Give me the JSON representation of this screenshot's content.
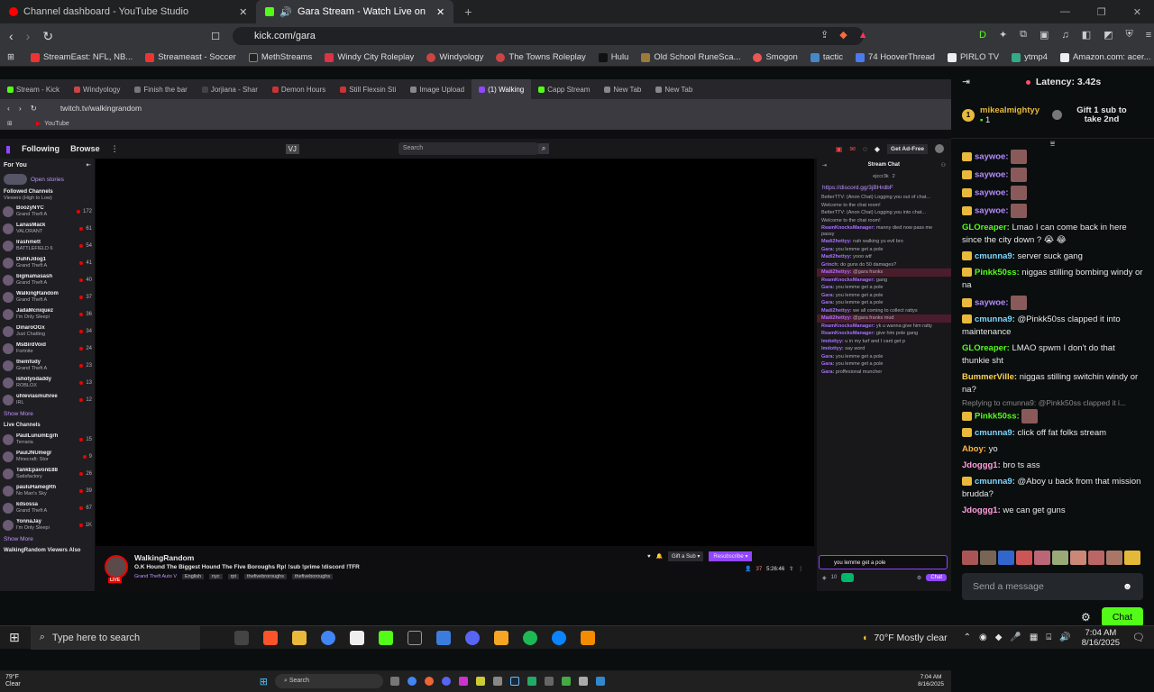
{
  "outer_tabs": [
    {
      "label": "Channel dashboard - YouTube Studio",
      "color": "#ff0000"
    },
    {
      "label": "Gara Stream - Watch Live on",
      "color": "#53fc18"
    }
  ],
  "outer_url": "kick.com/gara",
  "bookmarks": [
    "StreamEast: NFL, NB...",
    "Streameast - Soccer",
    "MethStreams",
    "Windy City Roleplay",
    "Windyology",
    "The Towns Roleplay",
    "Hulu",
    "Old School RuneSca...",
    "Smogon",
    "tactic",
    "74 HooverThread",
    "PIRLO TV",
    "ytmp4",
    "Amazon.com: acer..."
  ],
  "inner_tabs": [
    "Stream - Kick",
    "Windyology",
    "Finish the bar",
    "Jorjiana - Shar",
    "Demon Hours",
    "Still Flexsin Sti",
    "Image Upload",
    "(1) Walking",
    "Capp Stream",
    "New Tab",
    "New Tab"
  ],
  "inner_url": "twitch.tv/walkingrandom",
  "inner_bookmark": "YouTube",
  "twitch": {
    "following": "Following",
    "browse": "Browse",
    "search": "Search",
    "get_ad_free": "Get Ad-Free",
    "for_you": "For You",
    "open_stories": "Open stories",
    "followed_header": "Followed Channels",
    "followed_sub": "Viewers (High to Low)",
    "followed": [
      {
        "n": "BoozyNYC",
        "g": "Grand Theft A",
        "v": "172"
      },
      {
        "n": "LanasMack",
        "g": "VALORANT",
        "v": "61"
      },
      {
        "n": "Irashmett",
        "g": "BATTLEFIELD 6",
        "v": "54"
      },
      {
        "n": "DuhhJdog1",
        "g": "Grand Theft A",
        "v": "41"
      },
      {
        "n": "bigmamasash",
        "g": "Grand Theft A",
        "v": "40"
      },
      {
        "n": "WalkingRandom",
        "g": "Grand Theft A",
        "v": "37"
      },
      {
        "n": "JadaMcniquez",
        "g": "I'm Only Sleepi",
        "v": "36"
      },
      {
        "n": "DinaroOGx",
        "g": "Just Chatting",
        "v": "34"
      },
      {
        "n": "MsBirdVoid",
        "g": "Fortnite",
        "v": "24"
      },
      {
        "n": "themfudy",
        "g": "Grand Theft A",
        "v": "23"
      },
      {
        "n": "ishotyodaddy",
        "g": "ROBLOX",
        "v": "13"
      },
      {
        "n": "uhleviasmuhree",
        "g": "IRL",
        "v": "12"
      }
    ],
    "show_more": "Show More",
    "live_header": "Live Channels",
    "live": [
      {
        "n": "PaulLunumEgrh",
        "g": "Terraria",
        "v": "15"
      },
      {
        "n": "PaulJNUmegr",
        "g": "Minecraft: Stor",
        "v": "9"
      },
      {
        "n": "TankEpavonE88",
        "g": "Satisfactory",
        "v": "26"
      },
      {
        "n": "pauluHamegRh",
        "g": "No Man's Sky",
        "v": "39"
      },
      {
        "n": "kdsossa",
        "g": "Grand Theft A",
        "v": "67"
      },
      {
        "n": "YonnaJay",
        "g": "I'm Only Sleepi",
        "v": "1K"
      }
    ],
    "viewers_also": "WalkingRandom Viewers Also",
    "weather_temp": "79°F",
    "weather_cond": "Clear",
    "streamer": "WalkingRandom",
    "stream_title": "O.K Hound The Biggest Hound The Five Boroughs Rp! !sub !prime !discord !TFR",
    "stream_tags": [
      "Grand Theft Auto V",
      "English",
      "nyc",
      "rpt",
      "thefivebroroughs",
      "thefiveboroughs"
    ],
    "gift_sub": "Gift a Sub",
    "resubscribe": "Resubscribe",
    "viewers": "37",
    "uptime": "5:26:46",
    "stream_chat": "Stream Chat",
    "chat_user": "ejccr3k",
    "chat_count": "2",
    "discord_link": "https://discord.gg/3jBHrdbF",
    "chat": [
      {
        "u": "",
        "t": "BetterTTV: (Anon Chat) Logging you out of chat..."
      },
      {
        "u": "",
        "t": "Welcome to the chat room!"
      },
      {
        "u": "",
        "t": "BetterTTV: (Anon Chat) Logging you into chat..."
      },
      {
        "u": "",
        "t": "Welcome to the chat room!"
      },
      {
        "u": "ReamKnocksManager:",
        "t": "manny died now pass me passy"
      },
      {
        "u": "Madi2hettyy:",
        "t": "nah walking yu evil bro"
      },
      {
        "u": "Gara:",
        "t": "you lemme get a pole"
      },
      {
        "u": "Madi2hettyy:",
        "t": "yooo wtf"
      },
      {
        "u": "Grinch:",
        "t": "do guns do 50 damages?"
      },
      {
        "u": "Madi2hettyy:",
        "t": "@gara franks"
      },
      {
        "u": "ReamKnocksManager:",
        "t": "gang"
      },
      {
        "u": "Gara:",
        "t": "you lemme get a pole"
      },
      {
        "u": "Gara:",
        "t": "you lemme get a pole"
      },
      {
        "u": "Gara:",
        "t": "you lemme get a pole"
      },
      {
        "u": "Madi2hettyy:",
        "t": "we all coming to collect rattys"
      },
      {
        "u": "Madi2hettyy:",
        "t": "@gara franks mud"
      },
      {
        "u": "ReamKnocksManager:",
        "t": "yk u wanna give him ratty"
      },
      {
        "u": "ReamKnocksManager:",
        "t": "give him pole gang"
      },
      {
        "u": "lmdottyy:",
        "t": "u in my turf and I cant get p"
      },
      {
        "u": "lmdottyy:",
        "t": "say word"
      },
      {
        "u": "Gara:",
        "t": "you lemme get a pole"
      },
      {
        "u": "Gara:",
        "t": "you lemme get a pole"
      },
      {
        "u": "Gara:",
        "t": "proffesional muncher"
      }
    ],
    "chat_input": "you lemme get a pole",
    "chat_btn": "Chat",
    "points": "10"
  },
  "inner_taskbar": {
    "search": "Search",
    "time": "7:04 AM",
    "date": "8/16/2025"
  },
  "kick": {
    "latency": "Latency: 3.42s",
    "top_gifter": "mikealmightyy",
    "top_gifter_count": "1",
    "gift_promo": "Gift 1 sub to take 2nd",
    "messages": [
      {
        "u": "saywoe:",
        "c": "#b48cff",
        "t": "",
        "emote": true,
        "badge": true
      },
      {
        "u": "saywoe:",
        "c": "#b48cff",
        "t": "",
        "emote": true,
        "badge": true
      },
      {
        "u": "saywoe:",
        "c": "#b48cff",
        "t": "",
        "emote": true,
        "badge": true
      },
      {
        "u": "saywoe:",
        "c": "#b48cff",
        "t": "",
        "emote": true,
        "badge": true
      },
      {
        "u": "GLOreaper:",
        "c": "#53fc18",
        "t": "Lmao I can come back in here since the city down ? 😭 😂",
        "emote": false,
        "badge": false
      },
      {
        "u": "cmunna9:",
        "c": "#7fd6ff",
        "t": "server suck gang",
        "emote": false,
        "badge": true
      },
      {
        "u": "Pinkk50ss:",
        "c": "#53fc18",
        "t": "niggas stilling bombing windy or na",
        "emote": false,
        "badge": true
      },
      {
        "u": "saywoe:",
        "c": "#b48cff",
        "t": "",
        "emote": true,
        "badge": true
      },
      {
        "u": "cmunna9:",
        "c": "#7fd6ff",
        "t": "@Pinkk50ss clapped it into maintenance",
        "emote": false,
        "badge": true
      },
      {
        "u": "GLOreaper:",
        "c": "#53fc18",
        "t": "LMAO spwm I don't do that thunkie sht",
        "emote": false,
        "badge": false
      },
      {
        "u": "BummerVille:",
        "c": "#ffd24d",
        "t": "niggas stilling switchin windy or na?",
        "emote": false,
        "badge": false
      },
      {
        "u": "Pinkk50ss:",
        "c": "#53fc18",
        "t": "",
        "emote": true,
        "badge": true,
        "reply": "Replying to cmunna9: @Pinkk50ss clapped it i..."
      },
      {
        "u": "cmunna9:",
        "c": "#7fd6ff",
        "t": "click off fat folks stream",
        "emote": false,
        "badge": true
      },
      {
        "u": "Aboy:",
        "c": "#ffb347",
        "t": "yo",
        "emote": false,
        "badge": false
      },
      {
        "u": "Jdoggg1:",
        "c": "#ff9edb",
        "t": "bro ts ass",
        "emote": false,
        "badge": false
      },
      {
        "u": "cmunna9:",
        "c": "#7fd6ff",
        "t": "@Aboy u back from that mission brudda?",
        "emote": false,
        "badge": true
      },
      {
        "u": "Jdoggg1:",
        "c": "#ff9edb",
        "t": "we can get guns",
        "emote": false,
        "badge": false
      }
    ],
    "send_placeholder": "Send a message",
    "chat_btn": "Chat"
  },
  "taskbar": {
    "search": "Type here to search",
    "weather": "70°F  Mostly clear",
    "time": "7:04 AM",
    "date": "8/16/2025"
  }
}
